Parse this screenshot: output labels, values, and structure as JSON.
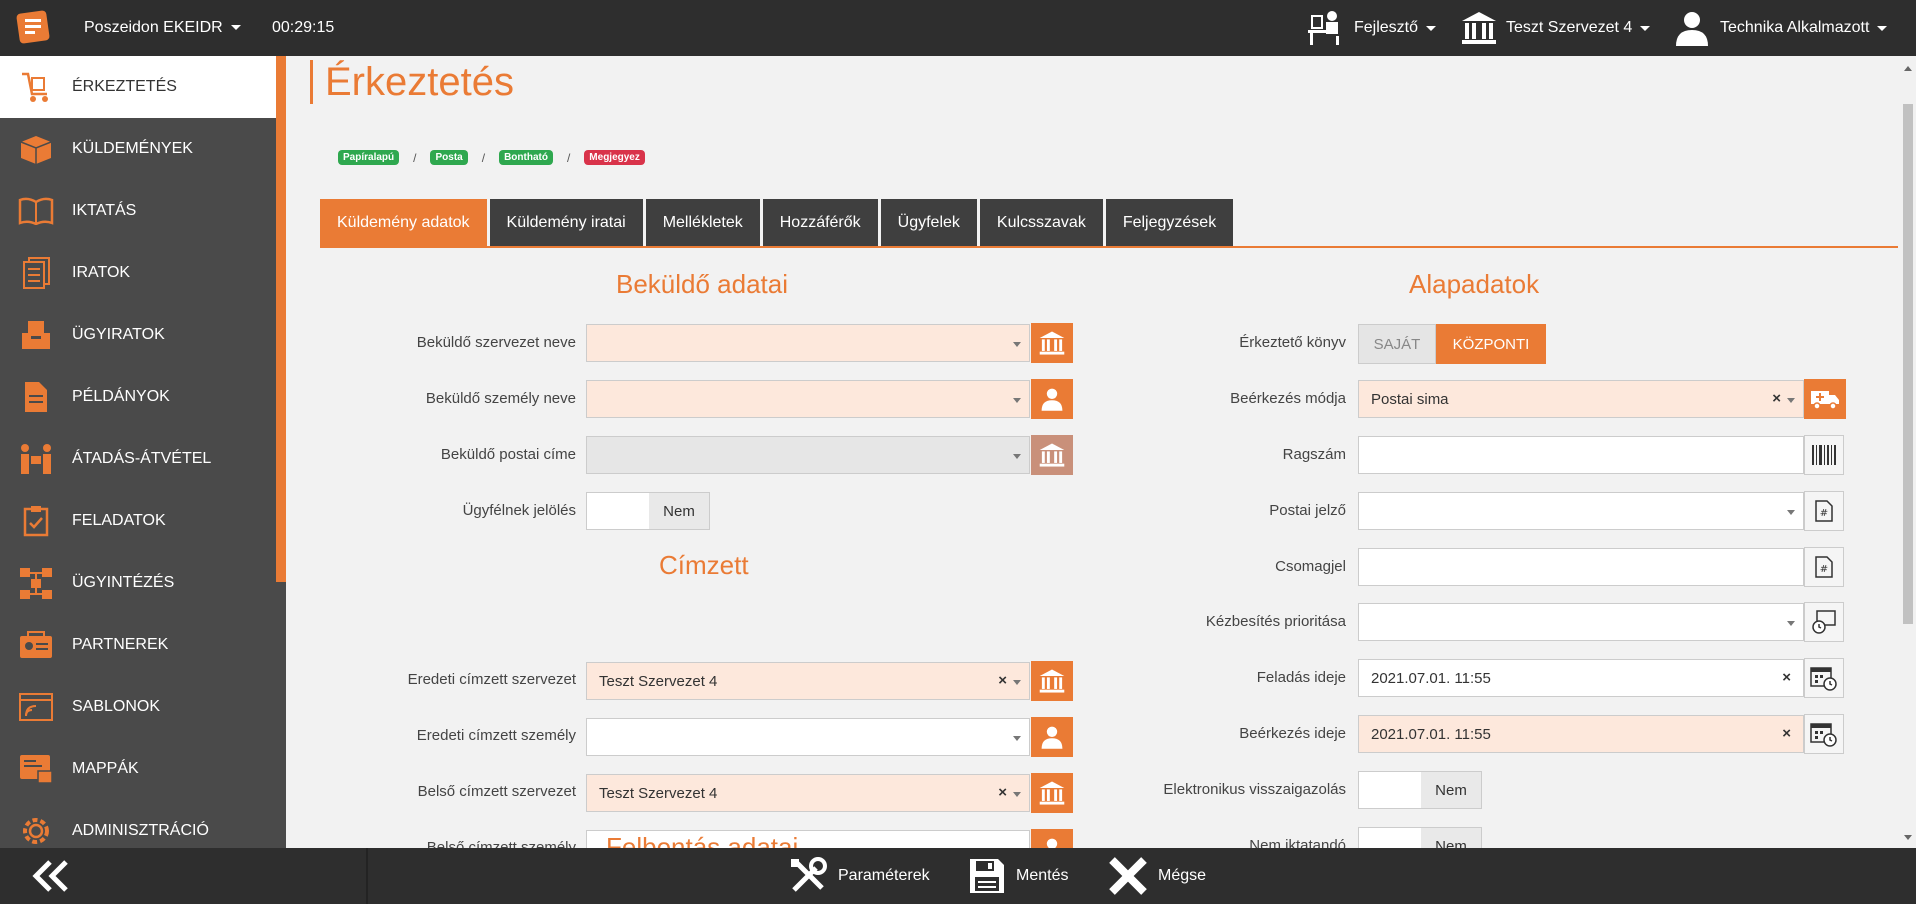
{
  "topbar": {
    "app_title": "Poszeidon EKEIDR",
    "timer": "00:29:15",
    "role": "Fejlesztő",
    "organization": "Teszt Szervezet 4",
    "user": "Technika Alkalmazott"
  },
  "sidebar": {
    "items": [
      {
        "label": "ÉRKEZTETÉS",
        "icon": "cart-icon"
      },
      {
        "label": "KÜLDEMÉNYEK",
        "icon": "package-icon"
      },
      {
        "label": "IKTATÁS",
        "icon": "book-icon"
      },
      {
        "label": "IRATOK",
        "icon": "documents-icon"
      },
      {
        "label": "ÜGYIRATOK",
        "icon": "folder-icon"
      },
      {
        "label": "PÉLDÁNYOK",
        "icon": "copies-icon"
      },
      {
        "label": "ÁTADÁS-ÁTVÉTEL",
        "icon": "handover-icon"
      },
      {
        "label": "FELADATOK",
        "icon": "tasks-icon"
      },
      {
        "label": "ÜGYINTÉZÉS",
        "icon": "workflow-icon"
      },
      {
        "label": "PARTNEREK",
        "icon": "partners-icon"
      },
      {
        "label": "SABLONOK",
        "icon": "template-icon"
      },
      {
        "label": "MAPPÁK",
        "icon": "mappak-icon"
      },
      {
        "label": "ADMINISZTRÁCIÓ",
        "icon": "gear-icon"
      }
    ]
  },
  "main": {
    "title": "Érkeztetés",
    "breadcrumb": [
      "Papíralapú",
      "Posta",
      "Bontható",
      "Megjegyez"
    ],
    "tabs": [
      "Küldemény adatok",
      "Küldemény iratai",
      "Mellékletek",
      "Hozzáférők",
      "Ügyfelek",
      "Kulcsszavak",
      "Feljegyzések"
    ]
  },
  "sender": {
    "title": "Beküldő adatai",
    "org_label": "Beküldő szervezet neve",
    "person_label": "Beküldő személy neve",
    "address_label": "Beküldő postai címe",
    "client_label": "Ügyfélnek jelölés",
    "client_value": "Nem"
  },
  "recipient": {
    "title": "Címzett",
    "orig_org_label": "Eredeti címzett szervezet",
    "orig_org_value": "Teszt Szervezet 4",
    "orig_person_label": "Eredeti címzett személy",
    "inner_org_label": "Belső címzett szervezet",
    "inner_org_value": "Teszt Szervezet 4",
    "inner_person_label": "Belső címzett személy"
  },
  "opening": {
    "title": "Felbontás adatai"
  },
  "basic": {
    "title": "Alapadatok",
    "book_label": "Érkeztető könyv",
    "book_own": "SAJÁT",
    "book_central": "KÖZPONTI",
    "arrival_mode_label": "Beérkezés módja",
    "arrival_mode_value": "Postai sima",
    "tracking_label": "Ragszám",
    "postal_mark_label": "Postai jelző",
    "package_label": "Csomagjel",
    "priority_label": "Kézbesítés prioritása",
    "sent_label": "Feladás ideje",
    "sent_value": "2021.07.01. 11:55",
    "arrived_label": "Beérkezés ideje",
    "arrived_value": "2021.07.01. 11:55",
    "e_confirm_label": "Elektronikus visszaigazolás",
    "e_confirm_value": "Nem",
    "no_register_label": "Nem iktatandó",
    "no_register_value": "Nem"
  },
  "bottombar": {
    "params": "Paraméterek",
    "save": "Mentés",
    "cancel": "Mégse"
  },
  "colors": {
    "accent": "#ea7b35",
    "dark": "#2e2e2e",
    "sidebar": "#4a4a4a",
    "peach": "#fde8dc"
  }
}
